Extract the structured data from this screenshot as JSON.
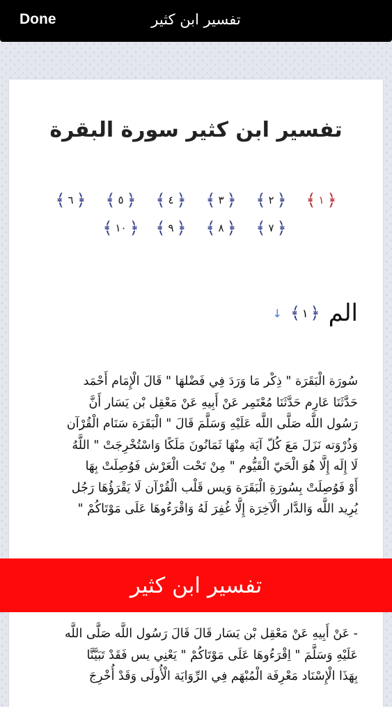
{
  "topbar": {
    "done_label": "Done",
    "title": "تفسير ابن كثير"
  },
  "page": {
    "title": "تفسير ابن كثير سورة البقرة",
    "verse_links_row1": [
      "١",
      "٢",
      "٣",
      "٤",
      "٥",
      "٦"
    ],
    "verse_links_row2": [
      "٧",
      "٨",
      "٩",
      "١٠"
    ],
    "active_verse": "١",
    "ornament_left": "﴿",
    "ornament_right": "﴾",
    "ayah": {
      "text": "الم",
      "number": "١",
      "arrow": "↓"
    },
    "tafsir_lines": [
      "سُورَة الْبَقَرَة \" ذِكْر مَا وَرَدَ فِي فَضْلهَا \" قَالَ الْإِمَام أَحْمَد",
      "حَدَّثَنَا عَارِم حَدَّثَنَا مُعْتَمِر عَنْ أَبِيهِ عَنْ مَعْقِل بْن يَسَار أَنَّ",
      "رَسُول اللَّه صَلَّى اللَّه عَلَيْهِ وَسَلَّمَ قَالَ \" الْبَقَرَة سَنَام الْقُرْآن",
      "وَذُرْوَته نَزَلَ مَعَ كُلّ آيَة مِنْهَا ثَمَانُونَ مَلَكًا وَاسْتُخْرِجَتْ \" اللَّهُ",
      "لَا إِلَه إِلَّا هُوَ الْحَيّ الْقَيُّوم \" مِنْ تَحْت الْعَرْش فَوُصِلَتْ بِهَا",
      "أَوْ فَوُصِلَتْ بِسُورَةِ الْبَقَرَة وَيس قَلْب الْقُرْآن لَا يَقْرَؤُهَا رَجُل",
      "يُرِيد اللَّه وَالدَّار الْآخِرَة إِلَّا غُفِرَ لَهُ وَاقْرَءُوهَا عَلَى مَوْتَاكُمْ \""
    ],
    "tafsir_lines_after": [
      "- عَنْ أَبِيهِ عَنْ مَعْقِل بْن يَسَار قَالَ قَالَ رَسُول اللَّه صَلَّى اللَّه",
      "عَلَيْهِ وَسَلَّمَ \" اِقْرَءُوهَا عَلَى مَوْتَاكُمْ \" يَعْنِي يس فَقَدْ تَبَيَّنَّا",
      "بِهَذَا الْإِسْنَاد مَعْرِفَة الْمُبْهَم فِي الرِّوَايَة الْأُولَى وَقَدْ أُخْرِجَ"
    ]
  },
  "banner": {
    "text": "تفسير ابن كثير",
    "color": "#ff0a0a"
  }
}
